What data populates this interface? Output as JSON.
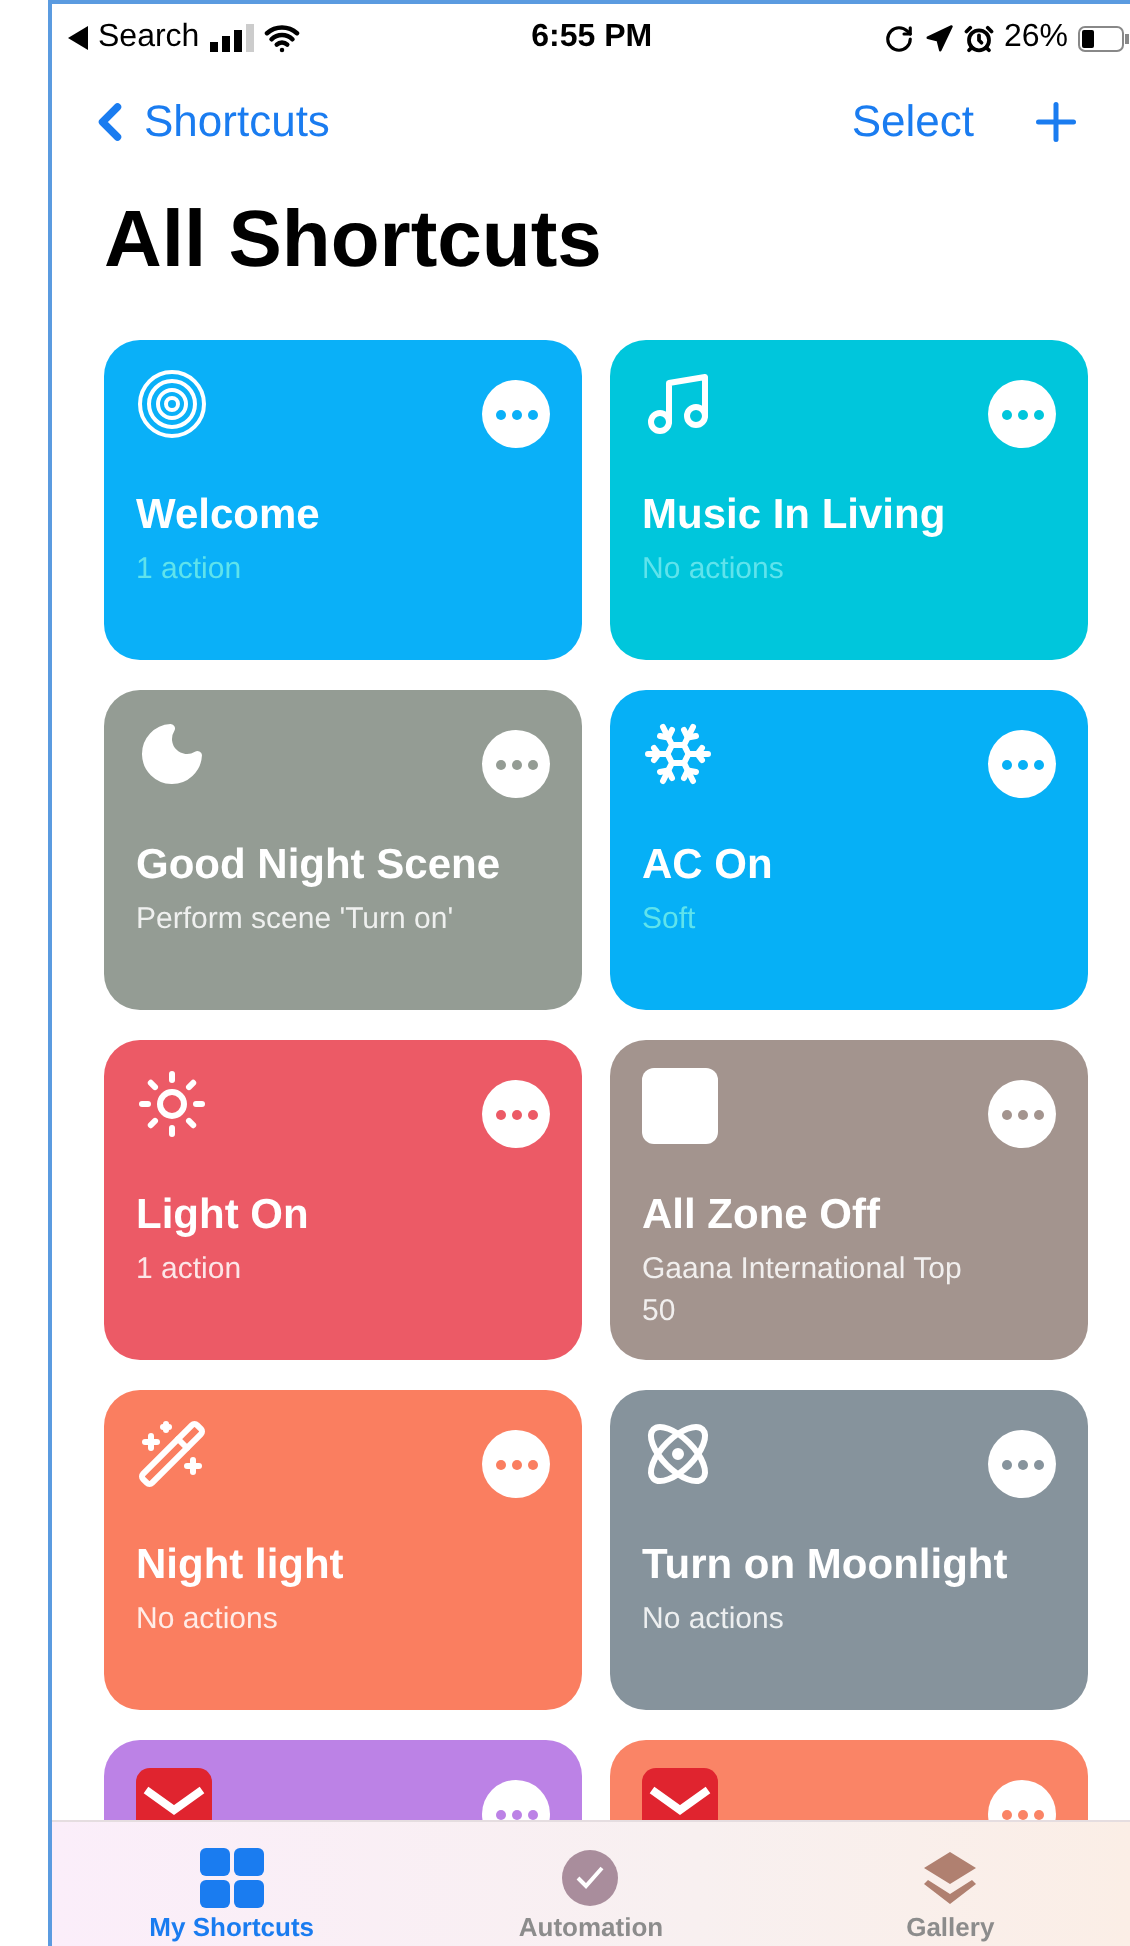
{
  "status_bar": {
    "back_label": "Search",
    "time": "6:55 PM",
    "battery": "26%"
  },
  "nav": {
    "back": "Shortcuts",
    "action": "Select"
  },
  "title": "All Shortcuts",
  "shortcuts": [
    {
      "kind": "full",
      "title": "Welcome",
      "subtitle": "1 action",
      "color": "#0ab0f8"
    },
    {
      "kind": "full",
      "title": "Music In Living",
      "subtitle": "No actions",
      "color": "#00c6dc"
    },
    {
      "kind": "full",
      "title": "Good Night Scene",
      "subtitle": "Perform scene 'Turn on'",
      "color": "#949c94"
    },
    {
      "kind": "full",
      "title": "AC On",
      "subtitle": "Soft",
      "color": "#06b0f6"
    },
    {
      "kind": "full",
      "title": "Light On",
      "subtitle": "1 action",
      "color": "#ec5a66"
    },
    {
      "kind": "full",
      "title": "All Zone Off",
      "subtitle": "Gaana International Top 50",
      "color": "#a3948e"
    },
    {
      "kind": "full",
      "title": "Night light",
      "subtitle": "No actions",
      "color": "#fa7e60"
    },
    {
      "kind": "full",
      "title": "Turn on Moonlight",
      "subtitle": "No actions",
      "color": "#86939c"
    },
    {
      "kind": "partial",
      "color": "#bc82e6"
    },
    {
      "kind": "partial",
      "color": "#fa8466"
    }
  ],
  "tabs": [
    {
      "label": "My Shortcuts",
      "selected": true
    },
    {
      "label": "Automation",
      "selected": false
    },
    {
      "label": "Gallery",
      "selected": false
    }
  ]
}
